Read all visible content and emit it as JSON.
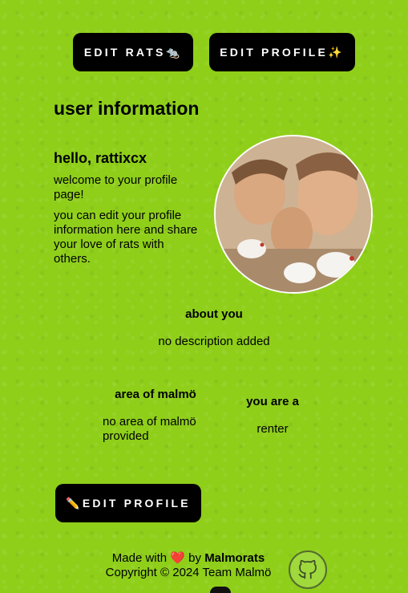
{
  "top_buttons": {
    "edit_rats": "EDIT RATS🐀",
    "edit_profile": "EDIT PROFILE✨"
  },
  "section_title": "user information",
  "profile": {
    "greeting": "hello, rattixcx",
    "welcome": "welcome to your profile page!",
    "info": "you can edit your profile information here and share your love of rats with others."
  },
  "about": {
    "heading": "about you",
    "value": "no description added"
  },
  "area": {
    "heading": "area of malmö",
    "value": "no area of malmö provided"
  },
  "status": {
    "heading": "you are a",
    "value": "renter"
  },
  "bottom_button": "✏️EDIT PROFILE",
  "footer": {
    "made_with": "Made with",
    "heart": "❤️",
    "by": "by",
    "brand": "Malmorats",
    "copyright": "Copyright © 2024 Team Malmö"
  },
  "icons": {
    "avatar": "profile-photo",
    "github": "github-icon"
  },
  "colors": {
    "background": "#8fcf1a",
    "button": "#000000"
  }
}
